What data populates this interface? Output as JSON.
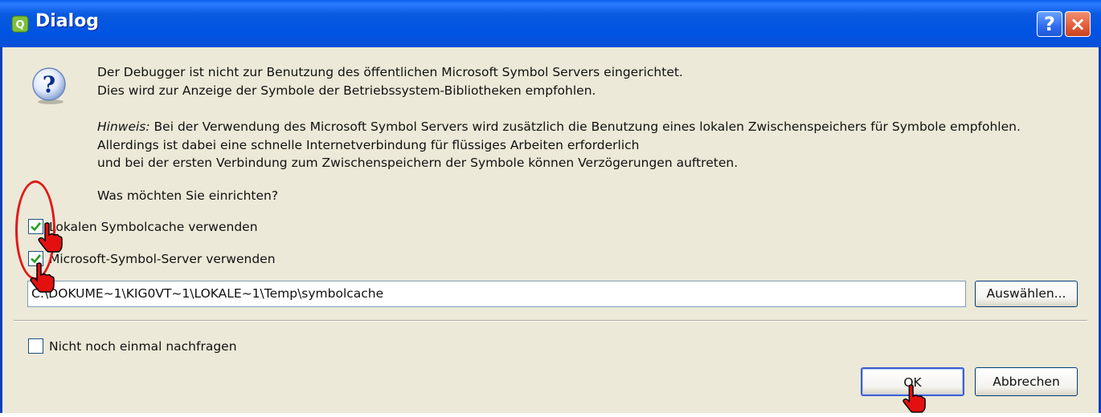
{
  "window": {
    "title": "Dialog",
    "help_glyph": "?",
    "close_glyph": "×"
  },
  "message": {
    "line1": "Der Debugger ist nicht zur Benutzung des öffentlichen Microsoft Symbol Servers eingerichtet.",
    "line2": "Dies wird zur Anzeige der Symbole der Betriebssystem-Bibliotheken empfohlen.",
    "hint_label": "Hinweis:",
    "hint_line1": " Bei der Verwendung des Microsoft Symbol Servers wird zusätzlich die Benutzung eines lokalen Zwischenspeichers für Symbole empfohlen.",
    "hint_line2": "Allerdings ist dabei eine schnelle Internetverbindung für flüssiges Arbeiten erforderlich",
    "hint_line3": "und bei der ersten Verbindung zum Zwischenspeichern der Symbole können Verzögerungen auftreten.",
    "question": "Was möchten Sie einrichten?"
  },
  "options": {
    "local_cache": {
      "label": "Lokalen Symbolcache verwenden",
      "checked": true
    },
    "ms_server": {
      "label": "Microsoft-Symbol-Server verwenden",
      "checked": true
    },
    "dont_ask": {
      "label": "Nicht noch einmal nachfragen",
      "checked": false
    }
  },
  "path": {
    "value": "C:\\DOKUME~1\\KIG0VT~1\\LOKALE~1\\Temp\\symbolcache"
  },
  "buttons": {
    "browse": "Auswählen...",
    "ok": "OK",
    "cancel": "Abbrechen"
  },
  "icons": {
    "app": "qt-creator-icon",
    "question": "question-icon",
    "help": "help-icon",
    "close": "close-icon",
    "cursor": "hand-cursor-icon"
  },
  "colors": {
    "titlebar": "#0054e3",
    "dialog_bg": "#ece9d8",
    "annotation": "#e01a1a",
    "checkmark": "#21a121"
  }
}
